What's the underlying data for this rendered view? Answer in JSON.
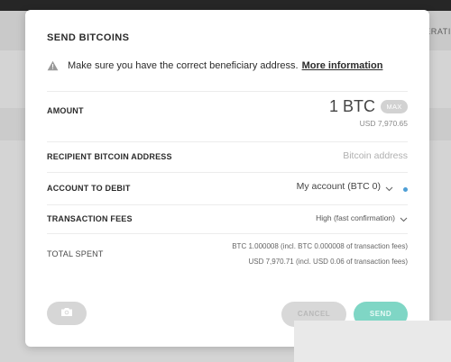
{
  "background": {
    "header_text": "PERATI"
  },
  "modal": {
    "title": "SEND BITCOINS",
    "warning": {
      "text": "Make sure you have the correct beneficiary address.",
      "link": "More information"
    },
    "amount": {
      "label": "AMOUNT",
      "value": "1 BTC",
      "max_label": "MAX",
      "usd": "USD 7,970.65"
    },
    "recipient": {
      "label": "RECIPIENT BITCOIN ADDRESS",
      "placeholder": "Bitcoin address",
      "value": ""
    },
    "account": {
      "label": "ACCOUNT TO DEBIT",
      "selected": "My account (BTC 0)"
    },
    "fees": {
      "label": "TRANSACTION FEES",
      "selected": "High (fast confirmation)"
    },
    "total": {
      "label": "TOTAL SPENT",
      "btc": "BTC 1.000008 (incl. BTC 0.000008 of transaction fees)",
      "usd": "USD 7,970.71 (incl. USD 0.06 of transaction fees)"
    },
    "buttons": {
      "cancel": "CANCEL",
      "send": "SEND"
    }
  },
  "colors": {
    "accent_send": "#7fd6c5",
    "status_dot": "#4e9fd6",
    "max_pill": "#d2d2d2"
  },
  "icons": {
    "warning": "warning-triangle-icon",
    "chevron": "chevron-down-icon",
    "camera": "camera-icon"
  }
}
